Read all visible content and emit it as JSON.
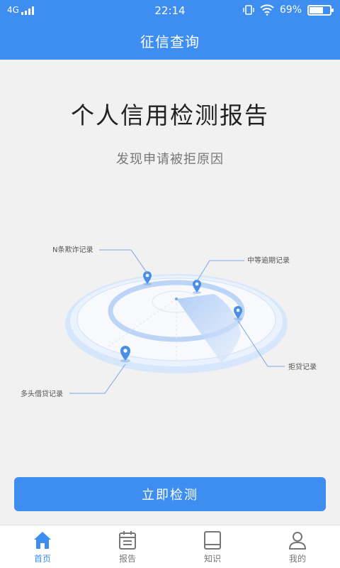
{
  "statusbar": {
    "network": "4G",
    "time": "22:14",
    "battery_text": "69%",
    "battery_level": 0.69
  },
  "navbar": {
    "title": "征信查询"
  },
  "hero": {
    "title": "个人信用检测报告",
    "subtitle": "发现申请被拒原因"
  },
  "radar": {
    "labels": {
      "fraud": "N条欺诈记录",
      "overdue": "中等逾期记录",
      "rejected": "拒贷记录",
      "multi_loan": "多头借贷记录"
    }
  },
  "cta": {
    "label": "立即检测"
  },
  "tabs": [
    {
      "label": "首页",
      "icon": "home-icon",
      "active": true
    },
    {
      "label": "报告",
      "icon": "calendar-icon",
      "active": false
    },
    {
      "label": "知识",
      "icon": "book-icon",
      "active": false
    },
    {
      "label": "我的",
      "icon": "user-icon",
      "active": false
    }
  ],
  "colors": {
    "primary": "#3d8ef0",
    "background": "#f1f1f1"
  }
}
